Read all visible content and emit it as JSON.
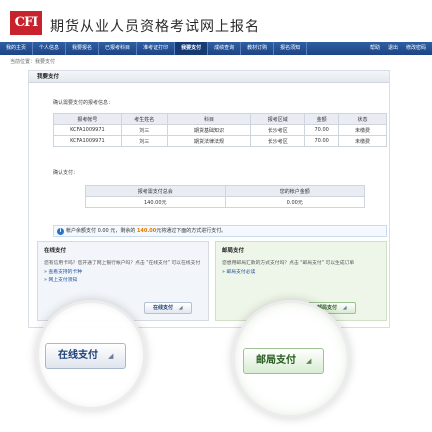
{
  "header": {
    "logo_text": "CFI",
    "title": "期货从业人员资格考试网上报名"
  },
  "nav": {
    "items": [
      "我的主页",
      "个人信息",
      "我要报名",
      "已报考科目",
      "准考证打印",
      "我要支付",
      "成绩查询",
      "教材订购",
      "报名须知"
    ],
    "active": "我要支付",
    "right_items": [
      "帮助",
      "退出",
      "修改密码"
    ]
  },
  "breadcrumb": "当前位置：我要支付",
  "panel": {
    "title": "我要支付",
    "confirm_label": "确认需要支付的报考信息：",
    "table": {
      "headers": [
        "报考帐号",
        "考生姓名",
        "科目",
        "报考区域",
        "金额",
        "状态"
      ],
      "rows": [
        [
          "KCFA1009971",
          "刘三",
          "期货基础知识",
          "长沙考区",
          "70.00",
          "未缴费"
        ],
        [
          "KCFA1009971",
          "刘三",
          "期货法律法规",
          "长沙考区",
          "70.00",
          "未缴费"
        ]
      ]
    },
    "pay_label": "确认支付：",
    "summary": {
      "headers": [
        "报考需支付总会",
        "您的帐户金额"
      ],
      "values": [
        "140.00元",
        "0.00元"
      ]
    },
    "notice": {
      "prefix": "帐户余额支付 0.00 元，剩余的 ",
      "amount": "140.00",
      "suffix": "元将通过下面的方式进行支付。"
    },
    "online": {
      "title": "在线支付",
      "text": "您有信用卡吗？您开通了网上银行帐户吗？点击 \"在线支付\" 可以在线支付",
      "links": [
        "查看支持的卡种",
        "网上支付须知"
      ],
      "button": "在线支付"
    },
    "postal": {
      "title": "邮局支付",
      "text": "您想用邮局汇款的方式支付吗？点击 \"邮局支付\" 可以生成订单",
      "links": [
        "邮局支付必读"
      ],
      "button": "邮局支付"
    }
  },
  "magnified": {
    "online_button": "在线支付",
    "postal_button": "邮局支付"
  },
  "colors": {
    "nav_blue": "#1d4486",
    "logo_red": "#c8232c",
    "highlight_orange": "#e07a00"
  }
}
